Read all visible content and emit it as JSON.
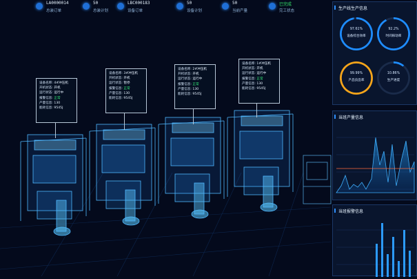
{
  "header": {
    "stats": [
      {
        "value": "LA0000014",
        "label": "总装订单",
        "icon": "order-icon"
      },
      {
        "value": "50",
        "label": "总装计划",
        "icon": "plan-icon"
      },
      {
        "value": "LBC000183",
        "label": "设备订单",
        "icon": "order-icon"
      },
      {
        "value": "50",
        "label": "设备计划",
        "icon": "plan-icon"
      },
      {
        "value": "50",
        "label": "当前产量",
        "icon": "output-icon"
      },
      {
        "value": "已完成",
        "label": "完工状态",
        "icon": "status-icon",
        "highlight": "#34e36a"
      }
    ]
  },
  "machines": [
    {
      "name": "4#冲压机",
      "power": "开机",
      "run": "运行中",
      "alarm": "正常",
      "output": "130",
      "energy": "9545J"
    },
    {
      "name": "3#冲压机",
      "power": "开机",
      "run": "暂停",
      "alarm": "正常",
      "output": "130",
      "energy": "9545J"
    },
    {
      "name": "2#冲压机",
      "power": "开机",
      "run": "运行中",
      "alarm": "正常",
      "output": "130",
      "energy": "9545J"
    },
    {
      "name": "1#冲压机",
      "power": "开机",
      "run": "运行中",
      "alarm": "正常",
      "output": "130",
      "energy": "9545J"
    }
  ],
  "machine_fields": {
    "name": "设备名称:",
    "power": "开机状态:",
    "run": "运行状态:",
    "alarm": "报警信息:",
    "output": "产量信息:",
    "energy": "能耗信息:"
  },
  "side_panels": {
    "production": {
      "title": "生产线生产信息",
      "gauges": [
        {
          "percent": "97.61%",
          "label": "设备综合效率",
          "value": 0.9761,
          "color": "#1e8cff"
        },
        {
          "percent": "92.2%",
          "label": "时间稼动率",
          "value": 0.922,
          "color": "#1e8cff"
        },
        {
          "percent": "99.99%",
          "label": "产品良品率",
          "value": 0.9999,
          "color": "#f4a41a"
        },
        {
          "percent": "10.86%",
          "label": "生产进度",
          "value": 0.1086,
          "color": "#1e8cff"
        }
      ]
    },
    "output": {
      "title": "当班产量信息"
    },
    "alarm": {
      "title": "当班报警信息"
    }
  },
  "colors": {
    "accent": "#2f8fff",
    "background": "#040a1c",
    "ok": "#36f07a"
  }
}
